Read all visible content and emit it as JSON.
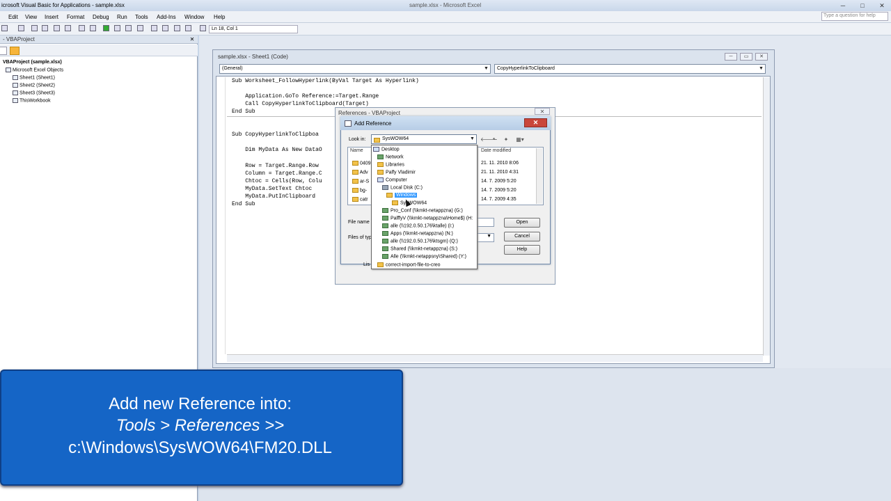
{
  "window": {
    "app_title": "icrosoft Visual Basic for Applications - sample.xlsx",
    "center_title": "sample.xlsx - Microsoft Excel",
    "help_placeholder": "Type a question for help"
  },
  "menu": [
    "Edit",
    "View",
    "Insert",
    "Format",
    "Debug",
    "Run",
    "Tools",
    "Add-Ins",
    "Window",
    "Help"
  ],
  "toolbar": {
    "position": "Ln 18, Col 1"
  },
  "project": {
    "panel_title": "- VBAProject",
    "root": "VBAProject (sample.xlsx)",
    "folder": "Microsoft Excel Objects",
    "items": [
      "Sheet1 (Sheet1)",
      "Sheet2 (Sheet2)",
      "Sheet3 (Sheet3)",
      "ThisWorkbook"
    ]
  },
  "code_window": {
    "title": "sample.xlsx - Sheet1 (Code)",
    "object_combo": "(General)",
    "proc_combo": "CopyHyperlinkToClipboard",
    "lines": [
      "Sub Worksheet_FollowHyperlink(ByVal Target As Hyperlink)",
      "    Application.GoTo Reference:=Target.Range",
      "    Call CopyHyperlinkToClipboard(Target)",
      "End Sub",
      "Sub CopyHyperlinkToClipboa",
      "    Dim MyData As New DataO",
      "    Row = Target.Range.Row",
      "    Column = Target.Range.C",
      "    Chtoc = Cells(Row, Colu",
      "    MyData.SetText Chtoc",
      "    MyData.PutInClipboard",
      "End Sub"
    ]
  },
  "references_dialog": {
    "title": "References - VBAProject",
    "close": "✕"
  },
  "add_reference": {
    "title": "Add Reference",
    "look_in_label": "Look in:",
    "look_in_value": "SysWOW64",
    "columns": {
      "name": "Name",
      "date": "Date modified"
    },
    "files": [
      "0409",
      "Adv",
      "ar-S",
      "bg-",
      "catr"
    ],
    "dates": [
      "21. 11. 2010 8:06",
      "21. 11. 2010 4:31",
      "14. 7. 2009 5:20",
      "14. 7. 2009 5:20",
      "14. 7. 2009 4:35"
    ],
    "file_name_label": "File name",
    "files_of_type_label": "Files of typ",
    "lis_label": "Lis",
    "buttons": {
      "open": "Open",
      "cancel": "Cancel",
      "help": "Help"
    },
    "dropdown": [
      {
        "label": "Desktop",
        "kind": "desk"
      },
      {
        "label": "Network",
        "kind": "net"
      },
      {
        "label": "Libraries",
        "kind": "folder"
      },
      {
        "label": "Palfy Vladimir",
        "kind": "folder"
      },
      {
        "label": "Computer",
        "kind": "desk"
      },
      {
        "label": "Local Disk (C:)",
        "kind": "drive"
      },
      {
        "label": "Windows",
        "kind": "folder"
      },
      {
        "label": "SysWOW64",
        "kind": "folder"
      },
      {
        "label": "Pro_Conf (\\\\kmkt-netappzna) (G:)",
        "kind": "net"
      },
      {
        "label": "PalffyV (\\\\kmkt-netappzna\\Home$) (H:",
        "kind": "net"
      },
      {
        "label": "alle (\\\\192.0.50.176\\ktalle) (I:)",
        "kind": "net"
      },
      {
        "label": "Apps (\\\\kmkt-netappzna) (N:)",
        "kind": "net"
      },
      {
        "label": "alle (\\\\192.0.50.176\\ktsgm) (Q:)",
        "kind": "net"
      },
      {
        "label": "Shared (\\\\kmkt-netappzna) (S:)",
        "kind": "net"
      },
      {
        "label": "Alle (\\\\kmkt-netappsny\\Shared) (Y:)",
        "kind": "net"
      },
      {
        "label": "correct-import-file-to-creo",
        "kind": "folder"
      }
    ]
  },
  "caption": {
    "line1": "Add new Reference into:",
    "line2": "Tools > References >>",
    "line3": "c:\\Windows\\SysWOW64\\FM20.DLL"
  }
}
